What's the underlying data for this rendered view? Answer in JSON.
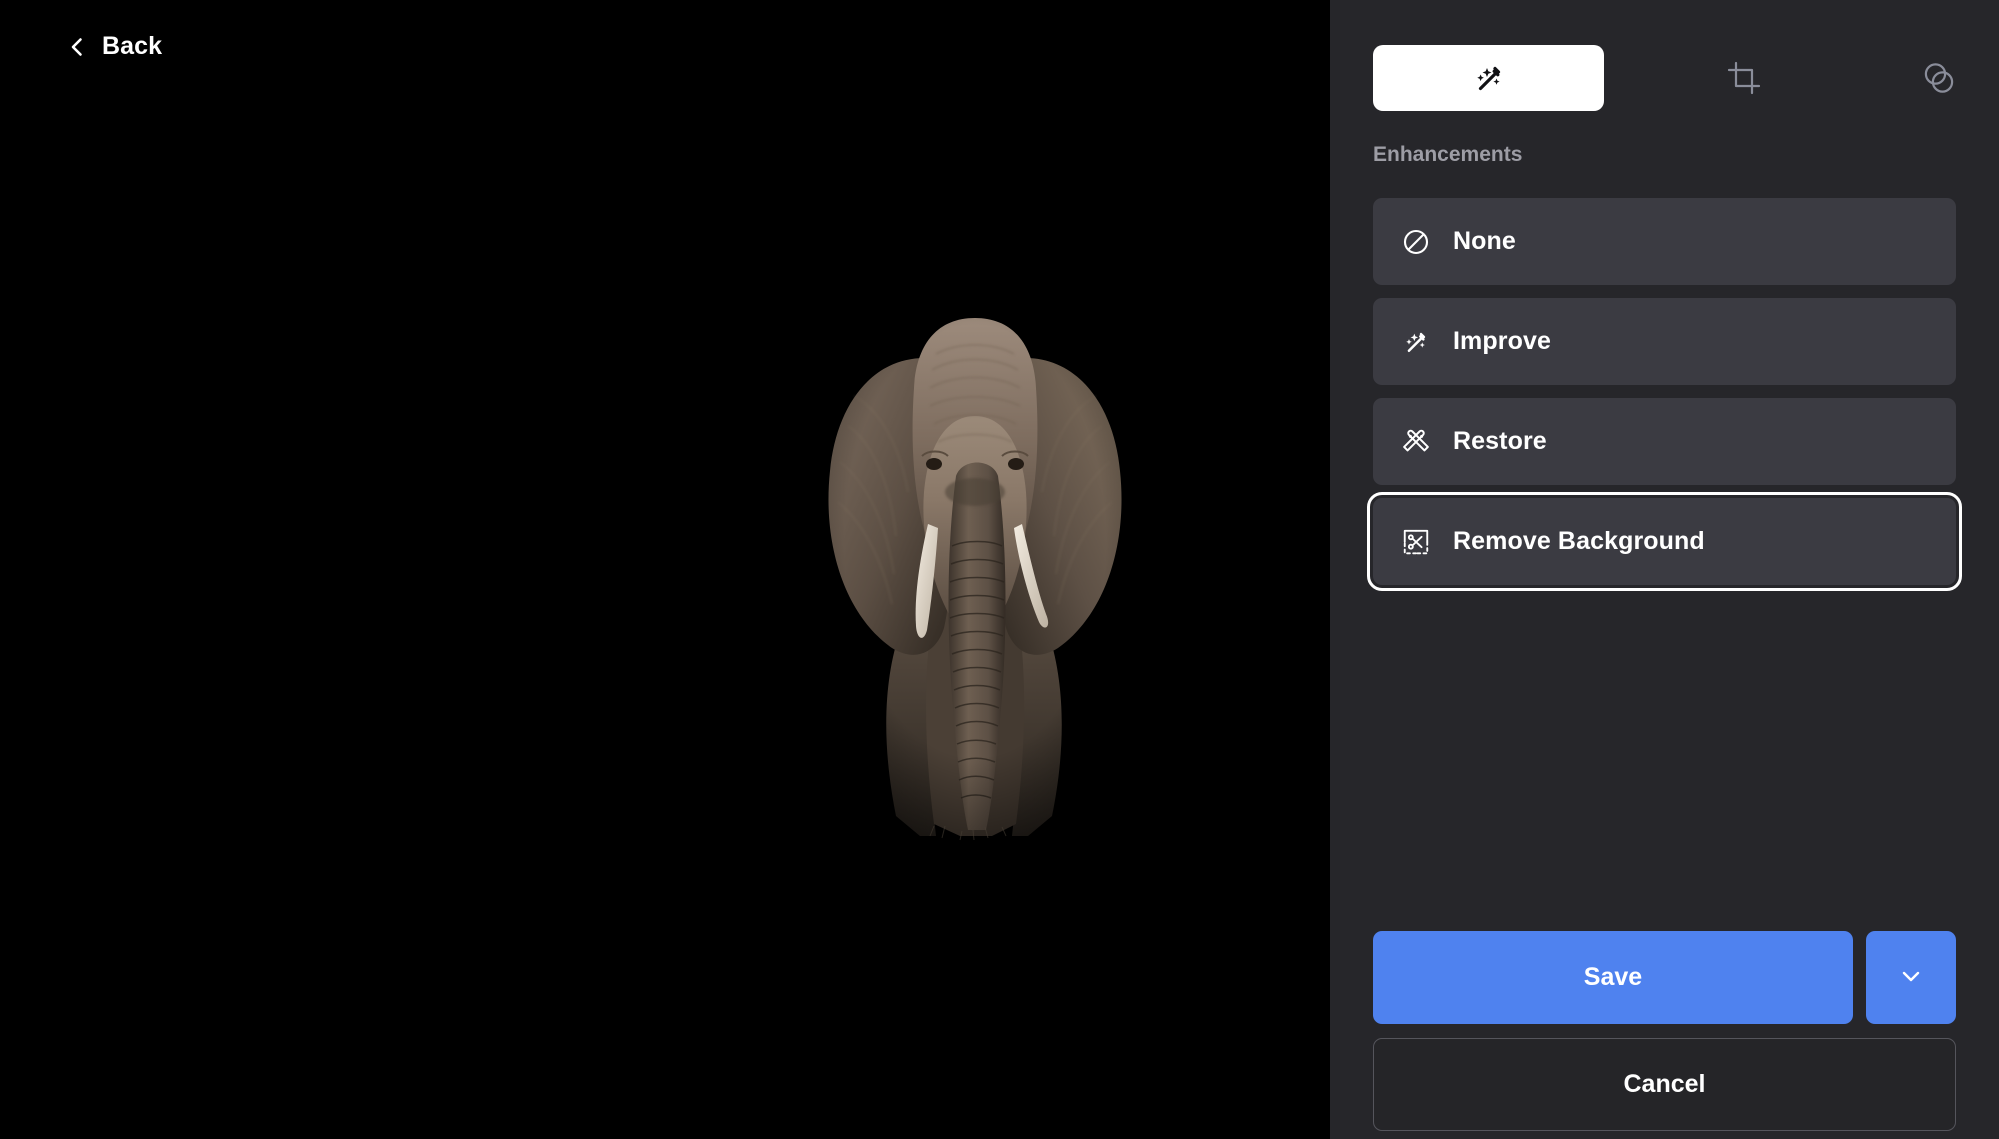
{
  "canvas": {
    "back_label": "Back",
    "back_icon": "chevron-left-icon",
    "image_subject": "elephant",
    "image_description": "Sepia-toned front-facing African elephant with background removed",
    "background_color": "#000000"
  },
  "panel": {
    "background_color": "#26262a",
    "tabs": [
      {
        "id": "enhance",
        "icon": "magic-wand-icon",
        "active": true
      },
      {
        "id": "crop",
        "icon": "crop-icon",
        "active": false
      },
      {
        "id": "adjust",
        "icon": "overlapping-circles-icon",
        "active": false
      }
    ],
    "section_title": "Enhancements",
    "enhancements": [
      {
        "id": "none",
        "label": "None",
        "icon": "prohibition-icon",
        "focused": false
      },
      {
        "id": "improve",
        "label": "Improve",
        "icon": "magic-wand-icon",
        "focused": false
      },
      {
        "id": "restore",
        "label": "Restore",
        "icon": "crossed-tools-icon",
        "focused": false
      },
      {
        "id": "remove-background",
        "label": "Remove Background",
        "icon": "scissors-cutout-icon",
        "focused": true
      }
    ],
    "actions": {
      "save_label": "Save",
      "save_dropdown_icon": "chevron-down-icon",
      "cancel_label": "Cancel"
    },
    "colors": {
      "accent": "#4f82ef",
      "item_background": "#3b3b42",
      "focus_ring": "#ffffff",
      "muted_text": "#9d9da5",
      "inactive_icon": "#8a8d9a"
    }
  }
}
